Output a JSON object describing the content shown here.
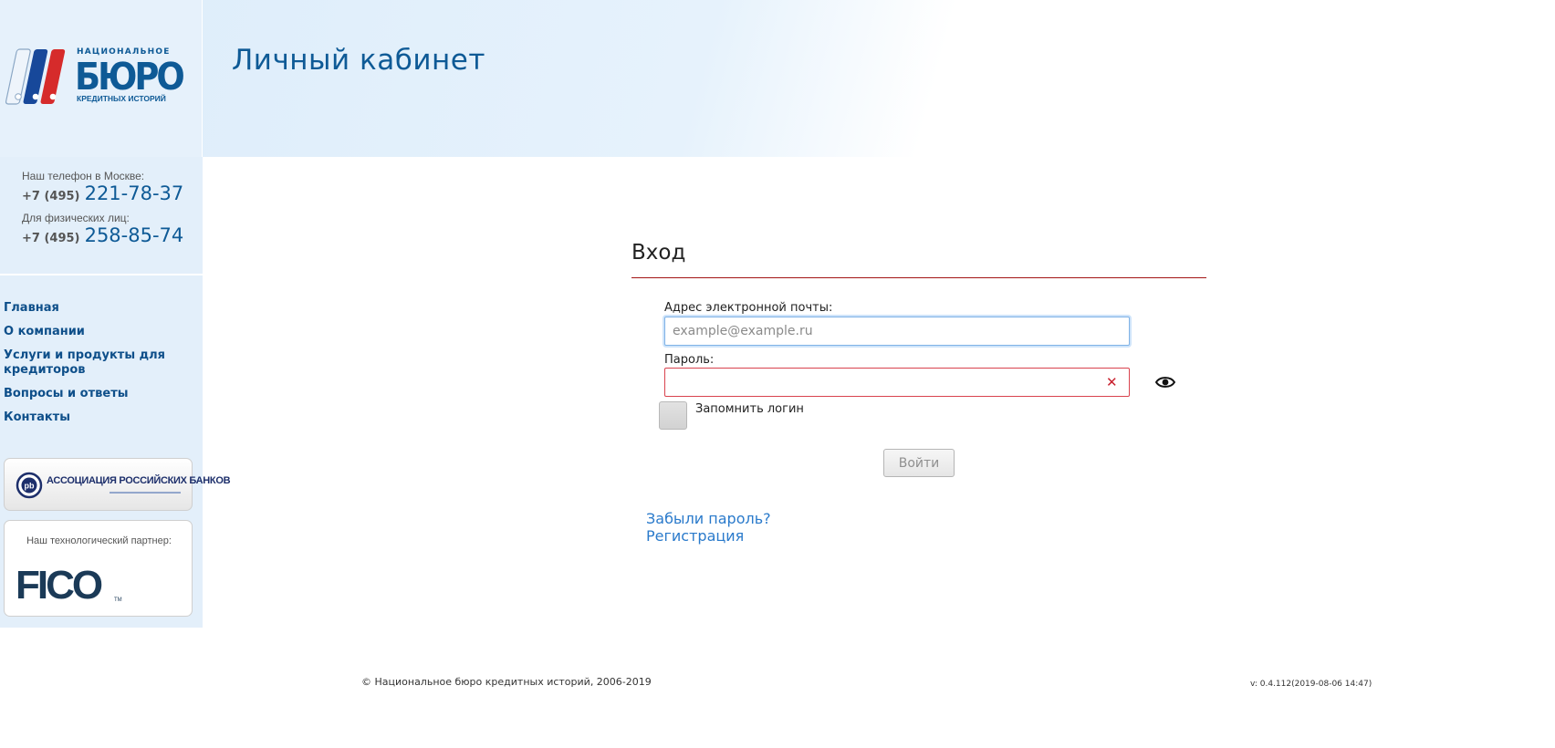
{
  "brand": {
    "logo_top": "НАЦИОНАЛЬНОЕ",
    "logo_main": "БЮРО",
    "logo_bottom": "КРЕДИТНЫХ ИСТОРИЙ",
    "accent_color": "#0e5a96",
    "red_color": "#d62b2b"
  },
  "header": {
    "title": "Личный кабинет"
  },
  "contacts": [
    {
      "label": "Наш телефон в Москве:",
      "code": "+7 (495)",
      "number": "221-78-37"
    },
    {
      "label": "Для физических лиц:",
      "code": "+7 (495)",
      "number": "258-85-74"
    }
  ],
  "nav": [
    {
      "label": "Главная"
    },
    {
      "label": "О компании"
    },
    {
      "label": "Услуги и продукты для кредиторов"
    },
    {
      "label": "Вопросы и ответы"
    },
    {
      "label": "Контакты"
    }
  ],
  "banners": {
    "arb_name": "АССОЦИАЦИЯ РОССИЙСКИХ БАНКОВ",
    "partner_label": "Наш технологический партнер:",
    "partner_logo": "FICO",
    "partner_tm": "TM"
  },
  "login": {
    "title": "Вход",
    "email_label": "Адрес электронной почты:",
    "email_placeholder": "example@example.ru",
    "email_value": "",
    "password_label": "Пароль:",
    "password_value": "",
    "remember_label": "Запомнить логин",
    "remember_checked": false,
    "submit_label": "Войти",
    "forgot_link": "Забыли пароль?",
    "register_link": "Регистрация",
    "icons": {
      "clear": "close-icon",
      "reveal": "eye-icon"
    }
  },
  "footer": {
    "copyright": "© Национальное бюро кредитных историй, 2006-2019",
    "version": "v: 0.4.112(2019-08-06 14:47)"
  }
}
